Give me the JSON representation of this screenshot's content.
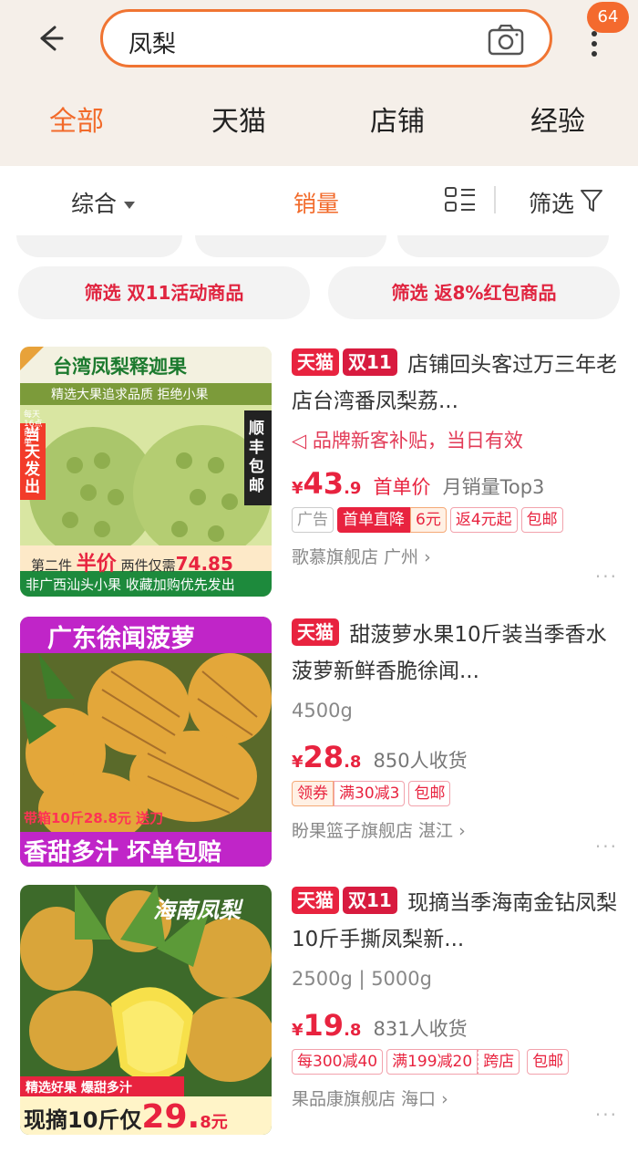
{
  "header": {
    "search_value": "凤梨",
    "badge": "64",
    "tabs": [
      {
        "label": "全部",
        "active": true
      },
      {
        "label": "天猫",
        "active": false
      },
      {
        "label": "店铺",
        "active": false
      },
      {
        "label": "经验",
        "active": false
      }
    ]
  },
  "sortbar": {
    "items": [
      {
        "label": "综合",
        "active": false
      },
      {
        "label": "销量",
        "active": true
      }
    ],
    "filter_label": "筛选"
  },
  "chips": [
    {
      "label": "筛选 双11活动商品"
    },
    {
      "label": "筛选 返8%红包商品"
    }
  ],
  "products": [
    {
      "badges": [
        "天猫",
        "双11"
      ],
      "title": "店铺回头客过万三年老店台湾番凤梨荔...",
      "promo": "品牌新客补贴，当日有效",
      "price_main": "43",
      "price_dec": ".9",
      "price_extra": "首单价",
      "price_extra2": "月销量Top3",
      "labels": [
        "广告",
        "首单直降",
        "6元",
        "返4元起",
        "包邮"
      ],
      "shop": "歌慕旗舰店 广州",
      "image_text": {
        "banner": "台湾凤梨释迦果",
        "sub": "精选大果追求品质 拒绝小果",
        "side_left": "当天发出",
        "side_left_small": "每天16点前订单",
        "side_right": "顺丰包邮",
        "bottom1_a": "第二件",
        "bottom1_b": "半价",
        "bottom1_c": "两件仅需",
        "bottom1_d": "74.85",
        "bottom2": "非广西汕头小果 收藏加购优先发出"
      }
    },
    {
      "badges": [
        "天猫"
      ],
      "title": "甜菠萝水果10斤装当季香水菠萝新鲜香脆徐闻...",
      "spec": "4500g",
      "price_main": "28",
      "price_dec": ".8",
      "price_extra": "850人收货",
      "labels": [
        "领券",
        "满30减3",
        "包邮"
      ],
      "shop": "盼果篮子旗舰店 湛江",
      "image_text": {
        "banner": "广东徐闻菠萝",
        "mid": "带箱10斤28.8元 送刀",
        "bottom": "香甜多汁 坏单包赔"
      }
    },
    {
      "badges": [
        "天猫",
        "双11"
      ],
      "title": "现摘当季海南金钻凤梨10斤手撕凤梨新...",
      "spec": "2500g | 5000g",
      "price_main": "19",
      "price_dec": ".8",
      "price_extra": "831人收货",
      "labels": [
        "每300减40",
        "满199减20",
        "跨店",
        "包邮"
      ],
      "shop": "果品康旗舰店 海口",
      "image_text": {
        "corner": "海南凤梨",
        "strip": "精选好果 爆甜多汁",
        "bottom_a": "现摘10斤仅",
        "bottom_b": "29.",
        "bottom_c": "8元"
      }
    }
  ],
  "colors": {
    "accent": "#f26a2a",
    "tmall_red": "#e8233f",
    "header_bg": "#f5efe9"
  }
}
